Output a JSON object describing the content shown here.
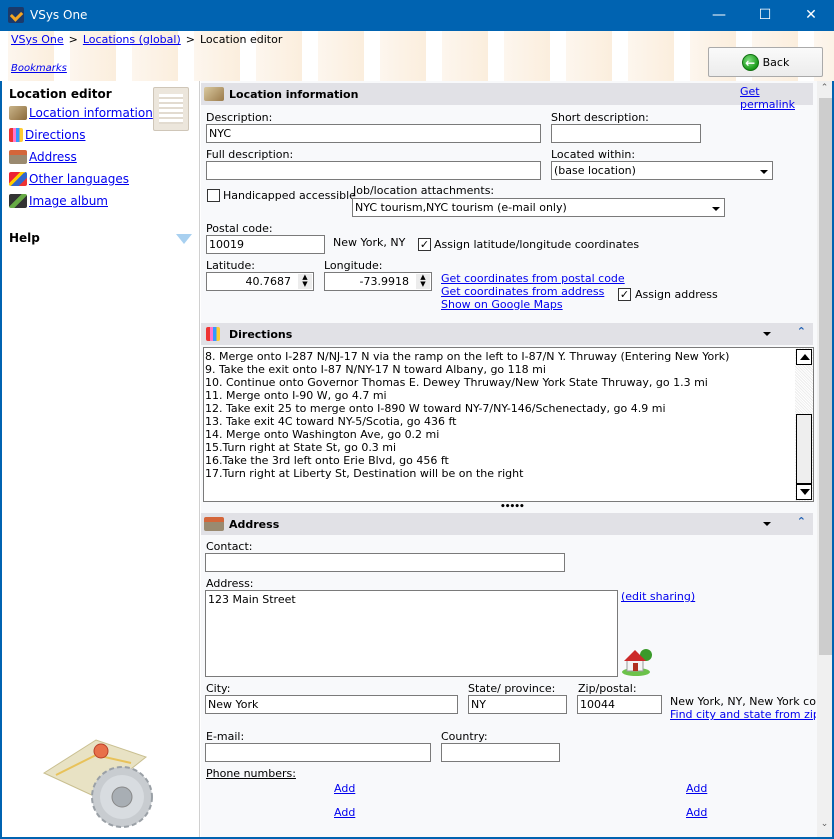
{
  "window": {
    "title": "VSys One",
    "minimize_icon": "minimize-icon",
    "maximize_icon": "maximize-icon",
    "close_icon": "close-icon"
  },
  "breadcrumb": {
    "items": [
      "VSys One",
      "Locations (global)",
      "Location editor"
    ],
    "separator": ">"
  },
  "bookmarks_label": "Bookmarks",
  "back_button": {
    "label": "Back",
    "icon": "back-arrow-icon"
  },
  "sidebar": {
    "title": "Location editor",
    "items": [
      {
        "label": "Location information",
        "icon": "location-pin-icon"
      },
      {
        "label": "Directions",
        "icon": "directions-icon"
      },
      {
        "label": "Address",
        "icon": "house-icon"
      },
      {
        "label": "Other languages",
        "icon": "flags-icon"
      },
      {
        "label": "Image album",
        "icon": "photo-album-icon"
      }
    ],
    "help_label": "Help"
  },
  "location_info": {
    "title": "Location information",
    "permalink": "Get permalink",
    "description_label": "Description:",
    "description_value": "NYC",
    "short_description_label": "Short description:",
    "short_description_value": "",
    "full_description_label": "Full description:",
    "full_description_value": "",
    "located_within_label": "Located within:",
    "located_within_value": "(base location)",
    "handicapped_label": "Handicapped accessible",
    "handicapped_checked": false,
    "attachments_label": "Job/location attachments:",
    "attachments_value": "NYC tourism,NYC tourism (e-mail only)",
    "postal_code_label": "Postal code:",
    "postal_code_value": "10019",
    "postal_city": "New York, NY",
    "assign_coords_label": "Assign latitude/longitude coordinates",
    "assign_coords_checked": true,
    "latitude_label": "Latitude:",
    "latitude_value": "40.7687",
    "longitude_label": "Longitude:",
    "longitude_value": "-73.9918",
    "links": [
      "Get coordinates from postal code",
      "Get coordinates from address",
      "Show on Google Maps"
    ],
    "assign_address_label": "Assign address",
    "assign_address_checked": true
  },
  "directions": {
    "title": "Directions",
    "lines": [
      "8. Merge onto I-287 N/NJ-17 N via the ramp on the left to I-87/N Y. Thruway (Entering New York)",
      "9. Take the exit onto I-87 N/NY-17 N toward Albany, go 118 mi",
      "10. Continue onto Governor Thomas E. Dewey Thruway/New York State Thruway, go 1.3 mi",
      "11. Merge onto I-90 W, go 4.7 mi",
      "12. Take exit 25 to merge onto I-890 W toward NY-7/NY-146/Schenectady, go 4.9 mi",
      "13. Take exit 4C toward NY-5/Scotia, go 436 ft",
      "14. Merge onto Washington Ave, go 0.2 mi",
      "15.Turn right at State St, go 0.3 mi",
      "16.Take the 3rd left onto Erie Blvd, go 456 ft",
      "17.Turn right at Liberty St, Destination will be on the right"
    ]
  },
  "address": {
    "title": "Address",
    "contact_label": "Contact:",
    "contact_value": "",
    "address_label": "Address:",
    "address_value": "123 Main Street",
    "edit_sharing": "(edit sharing)",
    "city_label": "City:",
    "city_value": "New York",
    "state_label": "State/ province:",
    "state_value": "NY",
    "zip_label": "Zip/postal:",
    "zip_value": "10044",
    "zip_lookup_result": "New York, NY, New York count",
    "find_city_link": "Find city and state from zip/po",
    "email_label": "E-mail:",
    "email_value": "",
    "country_label": "Country:",
    "country_value": "",
    "phone_label": "Phone numbers:",
    "add_links": [
      "Add",
      "Add",
      "Add",
      "Add"
    ]
  },
  "colors": {
    "titlebar": "#0063b1",
    "link": "#0000ee",
    "section_header": "#e1e1e6"
  }
}
